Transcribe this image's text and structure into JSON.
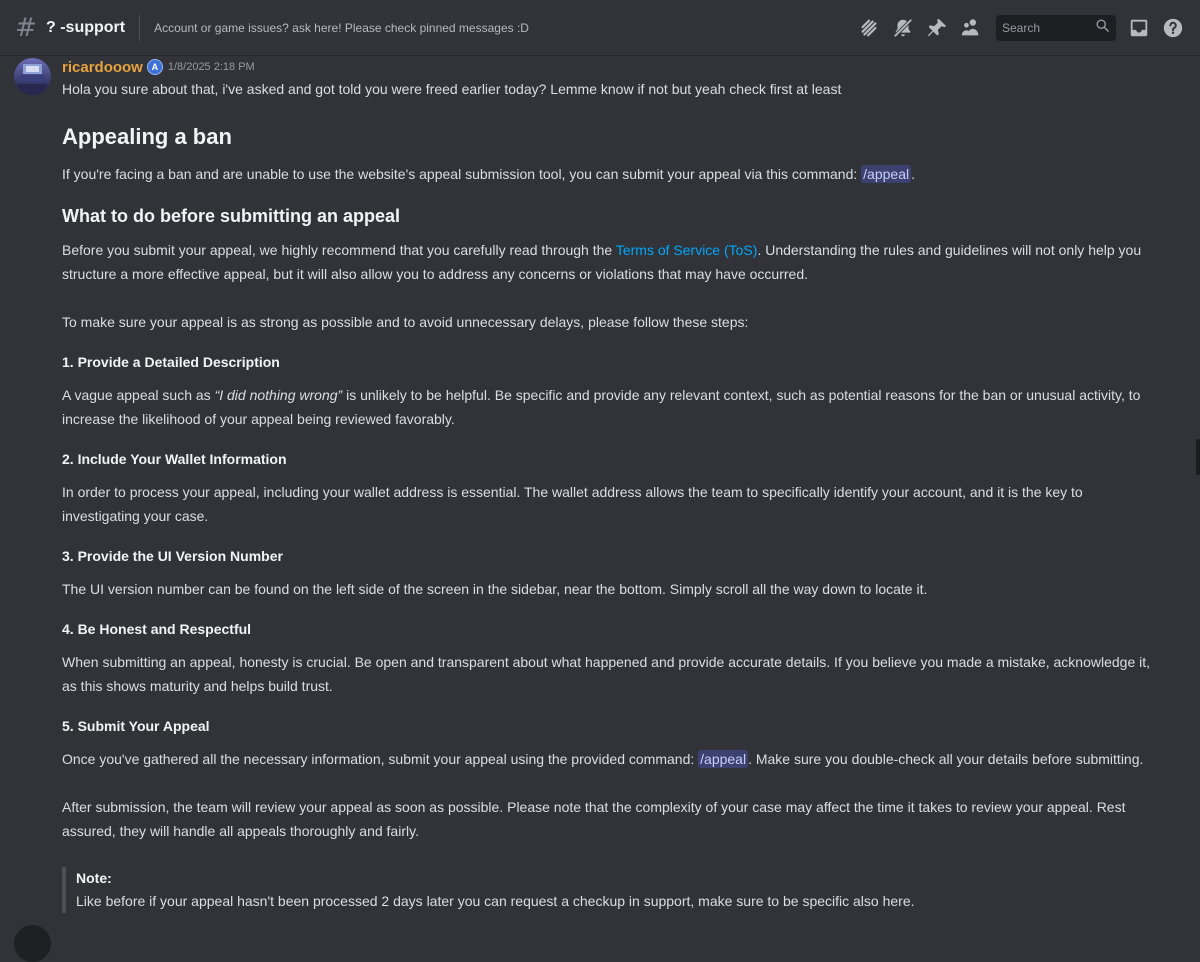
{
  "header": {
    "channel_name": "? -support",
    "topic": "Account or game issues? ask here! Please check pinned messages :D",
    "search_placeholder": "Search"
  },
  "message": {
    "username": "ricardooow",
    "role_badge": "A",
    "timestamp": "1/8/2025 2:18 PM",
    "intro": "Hola you sure about that, i've asked and got told you were freed earlier today? Lemme know if not but yeah check first at least",
    "heading": "Appealing a ban",
    "intro_para_pre": "If you're facing a ban and are unable to use the website's appeal submission tool, you can submit your appeal via this command: ",
    "command": "/appeal",
    "intro_para_post": ".",
    "subheading": "What to do before submitting an appeal",
    "before_para_pre": "Before you submit your appeal, we highly recommend that you carefully read through the ",
    "tos_link": "Terms of Service (ToS)",
    "before_para_post": ". Understanding the rules and guidelines will not only help you structure a more effective appeal, but it will also allow you to address any concerns or violations that may have occurred.",
    "steps_intro": "To make sure your appeal is as strong as possible and to avoid unnecessary delays, please follow these steps:",
    "step1_title": "1. Provide a Detailed Description",
    "step1_pre": "A vague appeal such as ",
    "step1_quote": "“I did nothing wrong”",
    "step1_post": " is unlikely to be helpful. Be specific and provide any relevant context, such as potential reasons for the ban or unusual activity, to increase the likelihood of your appeal being reviewed favorably.",
    "step2_title": "2. Include Your Wallet Information",
    "step2_text": "In order to process your appeal, including your wallet address is essential. The wallet address allows the team to specifically identify your account, and it is the key to investigating your case.",
    "step3_title": "3. Provide the UI Version Number",
    "step3_text": "The UI version number can be found on the left side of the screen in the sidebar, near the bottom. Simply scroll all the way down to locate it.",
    "step4_title": "4. Be Honest and Respectful",
    "step4_text": "When submitting an appeal, honesty is crucial. Be open and transparent about what happened and provide accurate details. If you believe you made a mistake, acknowledge it, as this shows maturity and helps build trust.",
    "step5_title": "5. Submit Your Appeal",
    "step5_pre": "Once you've gathered all the necessary information, submit your appeal using the provided command: ",
    "step5_command": "/appeal",
    "step5_post": ". Make sure you double-check all your details before submitting.",
    "after_text": "After submission, the team will review your appeal as soon as possible. Please note that the complexity of your case may affect the time it takes to review your appeal. Rest assured, they will handle all appeals thoroughly and fairly.",
    "note_title": "Note:",
    "note_text": "Like before if your appeal hasn't been processed 2 days later you can request a checkup in support, make sure to be specific also here."
  }
}
